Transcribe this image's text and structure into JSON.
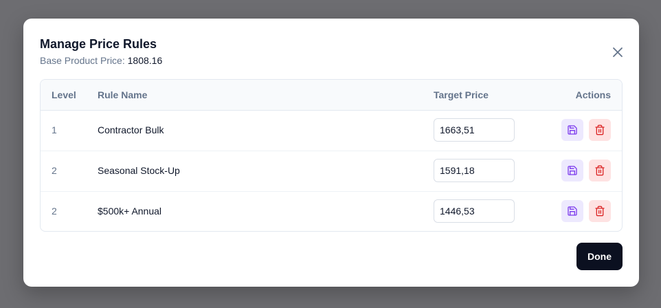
{
  "modal": {
    "title": "Manage Price Rules",
    "subtitle_label": "Base Product Price:",
    "base_price": "1808.16",
    "done_label": "Done"
  },
  "table": {
    "headers": {
      "level": "Level",
      "rule_name": "Rule Name",
      "target_price": "Target Price",
      "actions": "Actions"
    },
    "rows": [
      {
        "level": "1",
        "name": "Contractor Bulk",
        "price": "1663,51"
      },
      {
        "level": "2",
        "name": "Seasonal Stock-Up",
        "price": "1591,18"
      },
      {
        "level": "2",
        "name": "$500k+ Annual",
        "price": "1446,53"
      }
    ]
  },
  "colors": {
    "primary_dark": "#0b1020",
    "save_accent": "#7c3aed",
    "delete_accent": "#dc2626"
  },
  "icons": {
    "close": "close-icon",
    "save": "save-icon",
    "delete": "trash-icon"
  }
}
